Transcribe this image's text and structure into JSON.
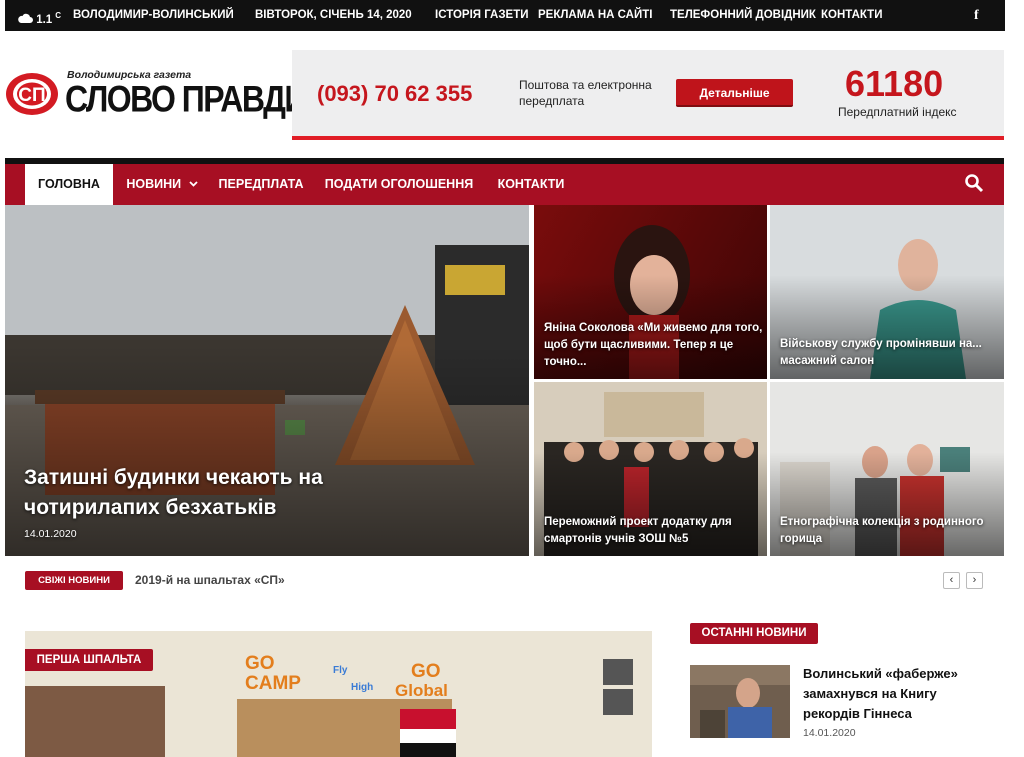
{
  "topbar": {
    "temperature": "1.1",
    "unit": "C",
    "city": "ВОЛОДИМИР-ВОЛИНСЬКИЙ",
    "date": "ВІВТОРОК, СІЧЕНЬ 14, 2020",
    "links": [
      "ІСТОРІЯ ГАЗЕТИ",
      "РЕКЛАМА НА САЙТІ",
      "ТЕЛЕФОННИЙ ДОВІДНИК",
      "КОНТАКТИ"
    ],
    "social_icon": "facebook-icon"
  },
  "header": {
    "logo_sub": "Володимирська газета",
    "logo_title": "СЛОВО ПРАВДИ",
    "logo_mark": "СП",
    "phone": "(093) 70 62 355",
    "promo_text": "Поштова та електронна передплата",
    "promo_button": "Детальніше",
    "index_number": "61180",
    "index_label": "Передплатний індекс"
  },
  "nav": {
    "items": [
      "ГОЛОВНА",
      "НОВИНИ",
      "ПЕРЕДПЛАТА",
      "ПОДАТИ ОГОЛОШЕННЯ",
      "КОНТАКТИ"
    ],
    "search_icon": "search-icon"
  },
  "hero": {
    "main": {
      "title": "Затишні будинки чекають на чотирилапих безхатьків",
      "date": "14.01.2020"
    },
    "tiles": [
      {
        "title": "Яніна Соколова «Ми живемо для того, щоб бути щасливими. Тепер я це точно..."
      },
      {
        "title": "Військову службу промінявши на... масажний салон"
      },
      {
        "title": "Переможний проект додатку для смартонів учнів ЗОШ №5"
      },
      {
        "title": "Етнографічна колекція з родинного горища"
      }
    ]
  },
  "ticker": {
    "label": "СВІЖІ НОВИНИ",
    "text": "2019-й на шпальтах «СП»",
    "prev_icon": "‹",
    "next_icon": "›"
  },
  "feature": {
    "badge": "ПЕРША ШПАЛЬТА",
    "banner1": "GO",
    "banner2": "CAMP",
    "banner3": "Fly",
    "banner4": "High",
    "banner5": "GO",
    "banner6": "Global"
  },
  "latest": {
    "heading": "ОСТАННІ НОВИНИ",
    "items": [
      {
        "title": "Волинський «фаберже» замахнувся на Книгу рекордів Гіннеса",
        "date": "14.01.2020"
      }
    ]
  },
  "colors": {
    "brand_red": "#a70f23",
    "accent_red": "#c5161d",
    "topbar": "#111111"
  }
}
